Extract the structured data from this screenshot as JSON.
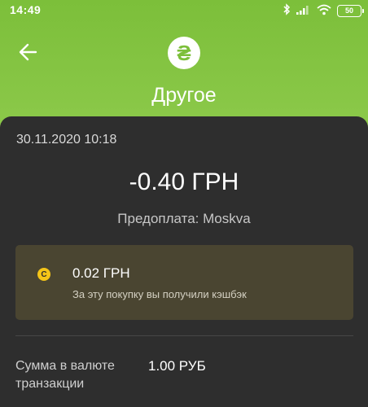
{
  "status_bar": {
    "time": "14:49",
    "battery": "50",
    "icons": [
      "bluetooth-icon",
      "signal-icon",
      "wifi-icon",
      "battery-icon"
    ]
  },
  "header": {
    "category_icon_glyph": "₴",
    "title": "Другое"
  },
  "transaction": {
    "datetime": "30.11.2020 10:18",
    "amount": "-0.40 ГРН",
    "merchant": "Предоплата: Moskva"
  },
  "cashback": {
    "coin_letter": "C",
    "amount": "0.02 ГРН",
    "note": "За эту покупку вы получили кэшбэк"
  },
  "details": [
    {
      "label": "Сумма в валюте транзакции",
      "value": "1.00 РУБ"
    }
  ],
  "colors": {
    "header_green": "#8bc34a",
    "card_background": "#2e2e2e",
    "cashback_background": "#4a4531",
    "coin_yellow": "#f5c518"
  }
}
